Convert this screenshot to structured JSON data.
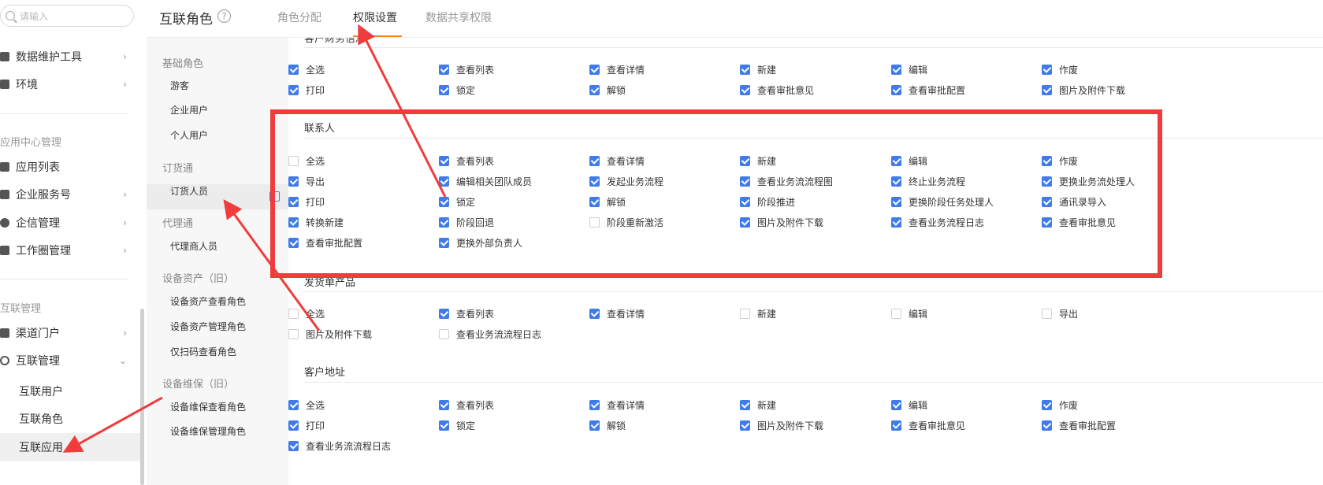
{
  "search": {
    "placeholder": "请输入"
  },
  "sidebar": {
    "items": [
      {
        "label": "数据维护工具",
        "icon": "chart-icon",
        "chevron": "›"
      },
      {
        "label": "环境",
        "icon": "monitor-icon",
        "chevron": "›"
      }
    ],
    "group_app": "应用中心管理",
    "app_items": [
      {
        "label": "应用列表",
        "icon": "grid-icon",
        "chevron": ""
      },
      {
        "label": "企业服务号",
        "icon": "monitor-icon",
        "chevron": "›"
      },
      {
        "label": "企信管理",
        "icon": "chat-icon",
        "chevron": "›"
      },
      {
        "label": "工作圈管理",
        "icon": "edit-icon",
        "chevron": "›"
      }
    ],
    "group_interconnect": "互联管理",
    "inter_items": [
      {
        "label": "渠道门户",
        "icon": "bar-chart-icon",
        "chevron": "›"
      },
      {
        "label": "互联管理",
        "icon": "link-icon",
        "chevron": "⌄"
      }
    ],
    "sub_items": [
      "互联用户",
      "互联角色",
      "互联应用"
    ]
  },
  "header": {
    "title": "互联角色",
    "help": "?",
    "tabs": [
      "角色分配",
      "权限设置",
      "数据共享权限"
    ]
  },
  "roles": {
    "groups": [
      {
        "name": "基础角色",
        "items": [
          "游客",
          "企业用户",
          "个人用户"
        ]
      },
      {
        "name": "订货通",
        "items": [
          "订货人员"
        ]
      },
      {
        "name": "代理通",
        "items": [
          "代理商人员"
        ]
      },
      {
        "name": "设备资产（旧）",
        "items": [
          "设备资产查看角色",
          "设备资产管理角色",
          "仅扫码查看角色"
        ]
      },
      {
        "name": "设备维保（旧）",
        "items": [
          "设备维保查看角色",
          "设备维保管理角色"
        ]
      }
    ]
  },
  "sections": {
    "top_title_partial": "客户财务信息",
    "top": [
      [
        "全选",
        true
      ],
      [
        "查看列表",
        true
      ],
      [
        "查看详情",
        true
      ],
      [
        "新建",
        true
      ],
      [
        "编辑",
        true
      ],
      [
        "作废",
        true
      ],
      [
        "打印",
        true
      ],
      [
        "锁定",
        true
      ],
      [
        "解锁",
        true
      ],
      [
        "查看审批意见",
        true
      ],
      [
        "查看审批配置",
        true
      ],
      [
        "图片及附件下载",
        true
      ]
    ],
    "contacts_title": "联系人",
    "contacts": [
      [
        "全选",
        false
      ],
      [
        "查看列表",
        true
      ],
      [
        "查看详情",
        true
      ],
      [
        "新建",
        true
      ],
      [
        "编辑",
        true
      ],
      [
        "作废",
        true
      ],
      [
        "导出",
        true
      ],
      [
        "编辑相关团队成员",
        true
      ],
      [
        "发起业务流程",
        true
      ],
      [
        "查看业务流流程图",
        true
      ],
      [
        "终止业务流程",
        true
      ],
      [
        "更换业务流处理人",
        true
      ],
      [
        "打印",
        true
      ],
      [
        "锁定",
        true
      ],
      [
        "解锁",
        true
      ],
      [
        "阶段推进",
        true
      ],
      [
        "更换阶段任务处理人",
        true
      ],
      [
        "通讯录导入",
        true
      ],
      [
        "转换新建",
        true
      ],
      [
        "阶段回退",
        true
      ],
      [
        "阶段重新激活",
        false
      ],
      [
        "图片及附件下载",
        true
      ],
      [
        "查看业务流程日志",
        true
      ],
      [
        "查看审批意见",
        true
      ],
      [
        "查看审批配置",
        true
      ],
      [
        "更换外部负责人",
        true
      ]
    ],
    "product_title": "发货单产品",
    "product": [
      [
        "全选",
        false
      ],
      [
        "查看列表",
        true
      ],
      [
        "查看详情",
        true
      ],
      [
        "新建",
        false
      ],
      [
        "编辑",
        false
      ],
      [
        "导出",
        false
      ],
      [
        "图片及附件下载",
        false
      ],
      [
        "查看业务流流程日志",
        false
      ]
    ],
    "address_title": "客户地址",
    "address": [
      [
        "全选",
        true
      ],
      [
        "查看列表",
        true
      ],
      [
        "查看详情",
        true
      ],
      [
        "新建",
        true
      ],
      [
        "编辑",
        true
      ],
      [
        "作废",
        true
      ],
      [
        "打印",
        true
      ],
      [
        "锁定",
        true
      ],
      [
        "解锁",
        true
      ],
      [
        "图片及附件下载",
        true
      ],
      [
        "查看审批意见",
        true
      ],
      [
        "查看审批配置",
        true
      ],
      [
        "查看业务流流程日志",
        true
      ]
    ]
  },
  "colors": {
    "accent": "#3f7bea",
    "tab_underline": "#f58220",
    "annotation": "#f03c3c"
  }
}
